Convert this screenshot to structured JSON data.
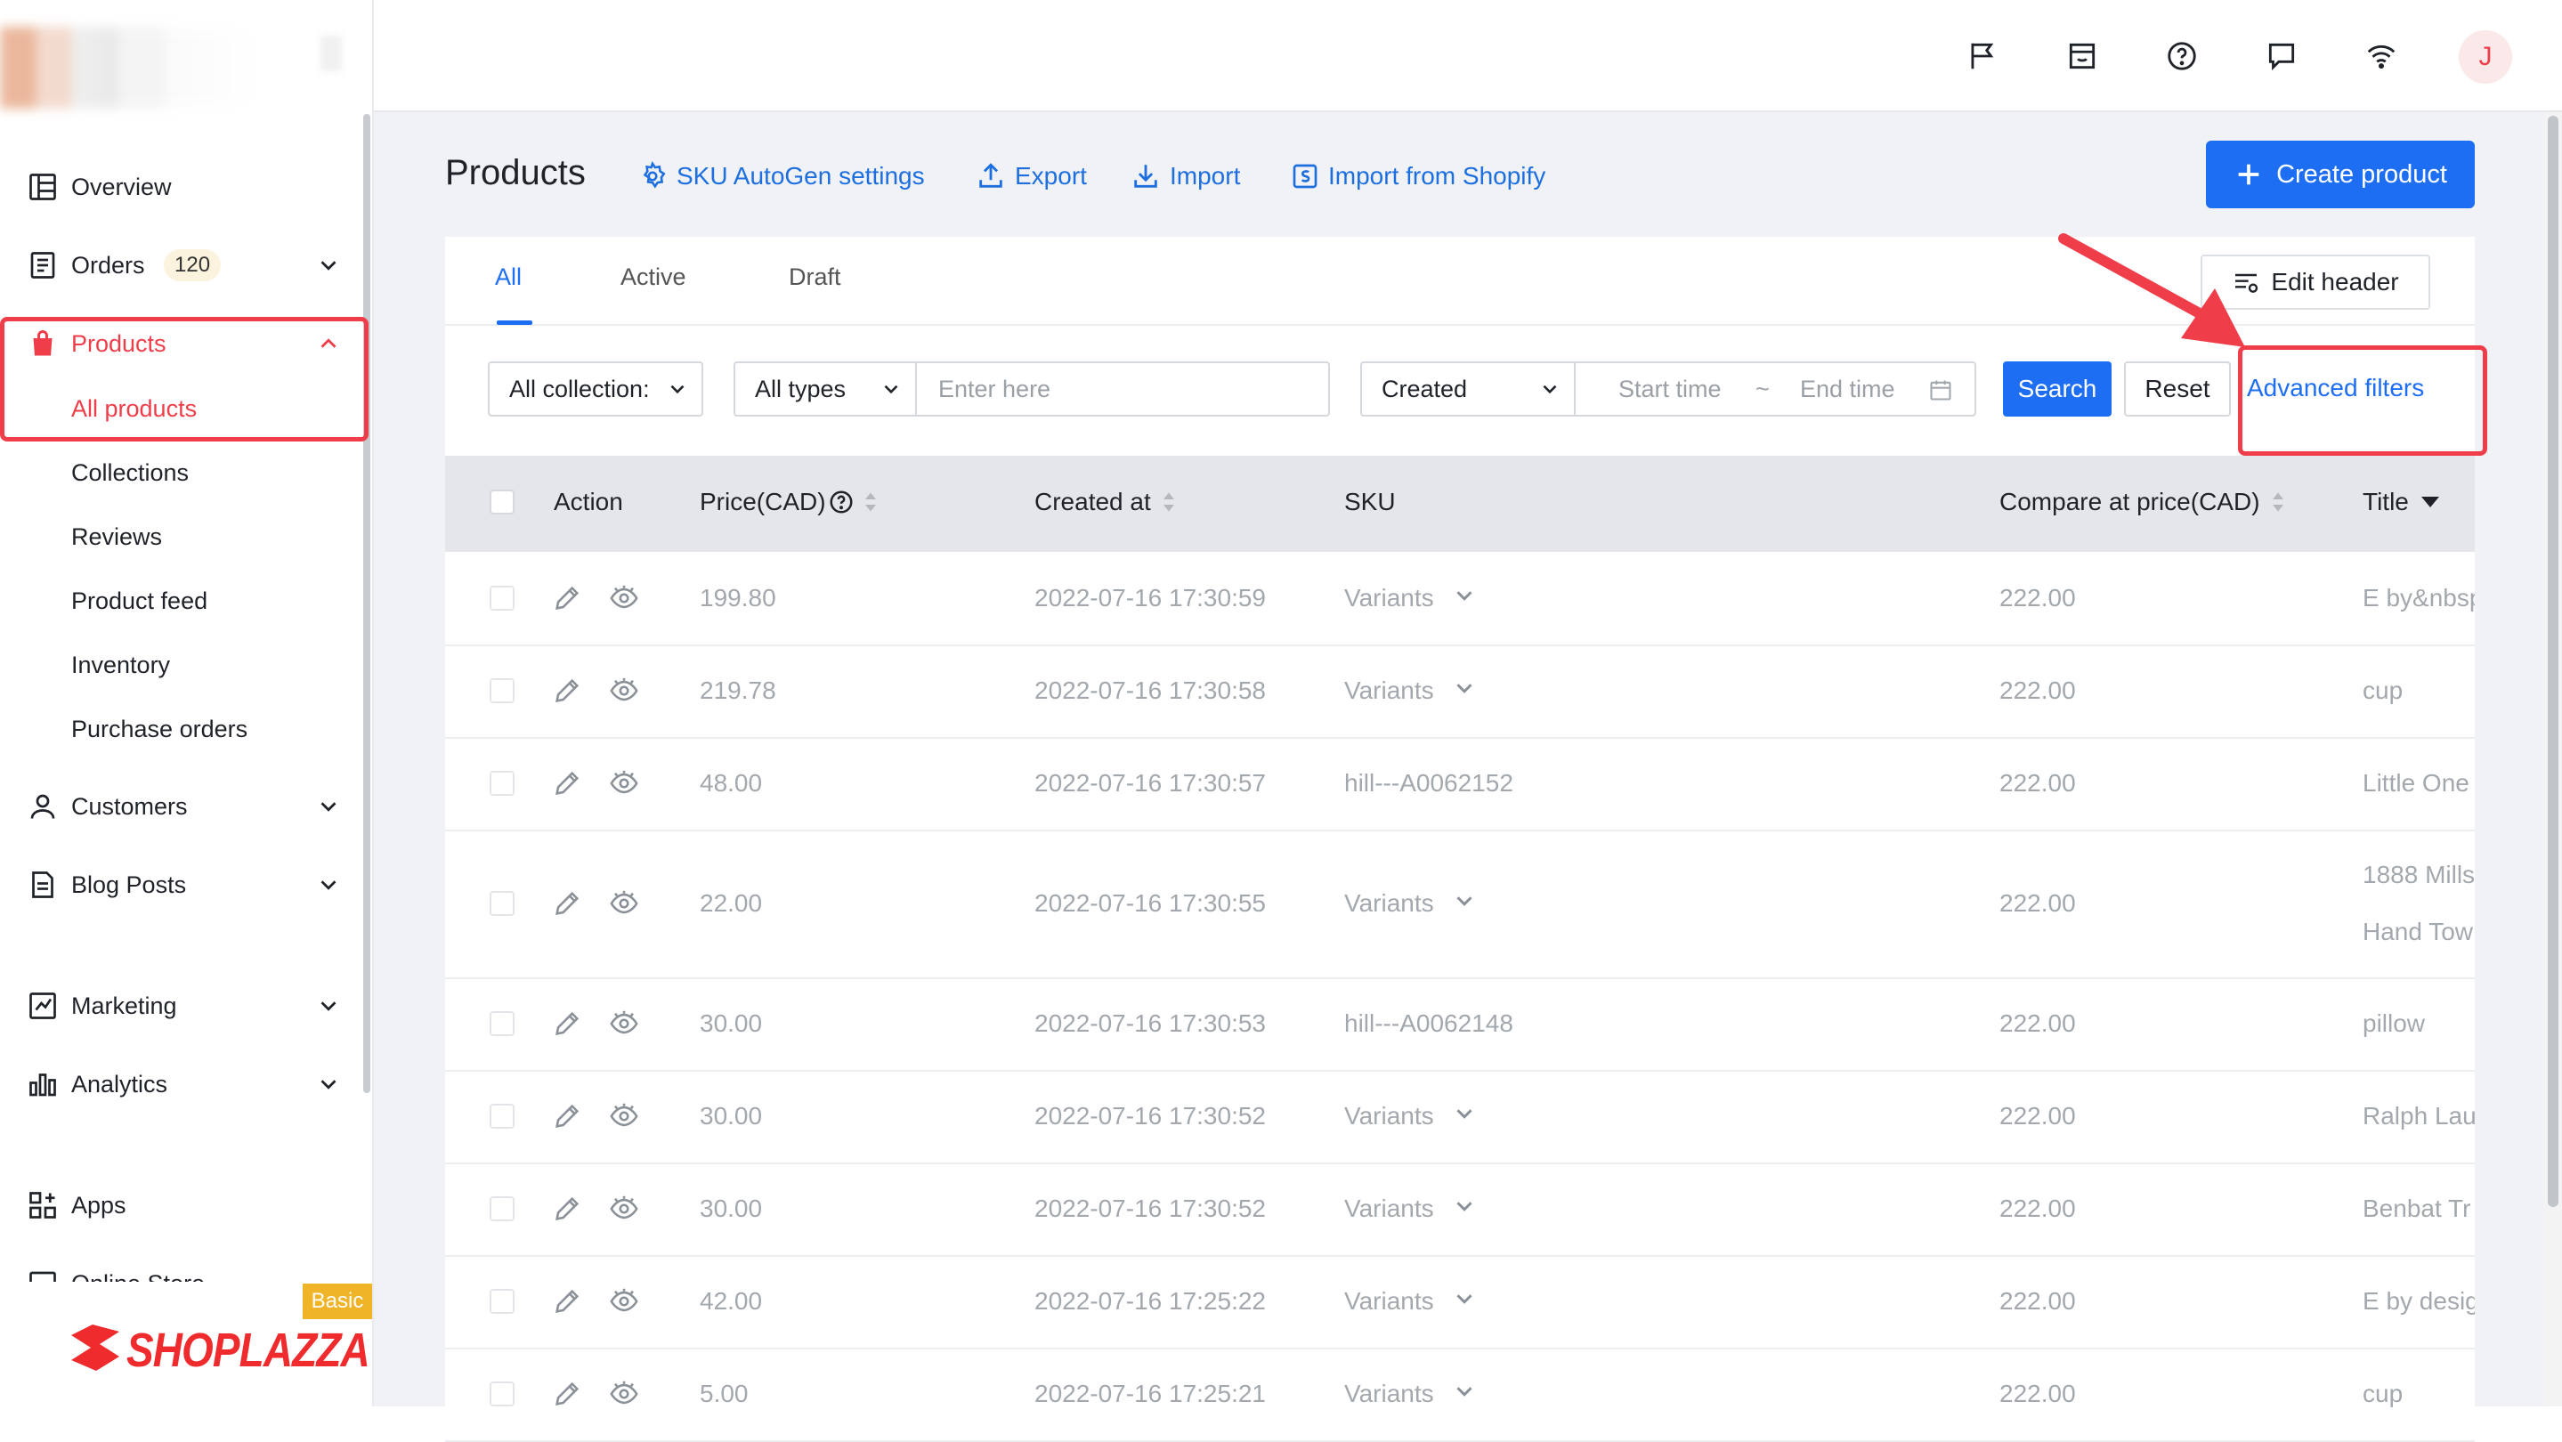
{
  "sidebar": {
    "items": [
      {
        "label": "Overview"
      },
      {
        "label": "Orders",
        "badge": "120"
      },
      {
        "label": "Products"
      },
      {
        "label": "Customers"
      },
      {
        "label": "Blog Posts"
      },
      {
        "label": "Marketing"
      },
      {
        "label": "Analytics"
      },
      {
        "label": "Apps"
      },
      {
        "label": "Online Store"
      }
    ],
    "product_subitems": [
      "All products",
      "Collections",
      "Reviews",
      "Product feed",
      "Inventory",
      "Purchase orders"
    ],
    "plan_badge": "Basic",
    "brand": "SHOPLAZZA"
  },
  "topbar": {
    "avatar_initial": "J"
  },
  "header": {
    "title": "Products",
    "sku_autogen": "SKU AutoGen settings",
    "export": "Export",
    "import": "Import",
    "import_shopify": "Import from Shopify",
    "create_product": "Create product"
  },
  "tabs": [
    "All",
    "Active",
    "Draft"
  ],
  "edit_header": "Edit header",
  "filters": {
    "collection": "All collection:",
    "types": "All types",
    "search_placeholder": "Enter here",
    "date_field": "Created",
    "start_placeholder": "Start time",
    "range_sep": "~",
    "end_placeholder": "End time",
    "search_button": "Search",
    "reset_button": "Reset",
    "advanced": "Advanced filters"
  },
  "columns": {
    "action": "Action",
    "price": "Price(CAD)",
    "created": "Created at",
    "sku": "SKU",
    "compare": "Compare at price(CAD)",
    "title": "Title"
  },
  "rows": [
    {
      "price": "199.80",
      "created": "2022-07-16 17:30:59",
      "sku": "Variants",
      "compare": "222.00",
      "title": [
        "E by&nbsp;"
      ]
    },
    {
      "price": "219.78",
      "created": "2022-07-16 17:30:58",
      "sku": "Variants",
      "compare": "222.00",
      "title": [
        "cup"
      ]
    },
    {
      "price": "48.00",
      "created": "2022-07-16 17:30:57",
      "sku": "hill---A0062152",
      "compare": "222.00",
      "title": [
        "Little One"
      ]
    },
    {
      "price": "22.00",
      "created": "2022-07-16 17:30:55",
      "sku": "Variants",
      "compare": "222.00",
      "title": [
        "1888 Mills",
        "Hand Tow"
      ]
    },
    {
      "price": "30.00",
      "created": "2022-07-16 17:30:53",
      "sku": "hill---A0062148",
      "compare": "222.00",
      "title": [
        "pillow"
      ]
    },
    {
      "price": "30.00",
      "created": "2022-07-16 17:30:52",
      "sku": "Variants",
      "compare": "222.00",
      "title": [
        "Ralph Lau"
      ]
    },
    {
      "price": "30.00",
      "created": "2022-07-16 17:30:52",
      "sku": "Variants",
      "compare": "222.00",
      "title": [
        "Benbat Tr"
      ]
    },
    {
      "price": "42.00",
      "created": "2022-07-16 17:25:22",
      "sku": "Variants",
      "compare": "222.00",
      "title": [
        "E by desig"
      ]
    },
    {
      "price": "5.00",
      "created": "2022-07-16 17:25:21",
      "sku": "Variants",
      "compare": "222.00",
      "title": [
        "cup"
      ]
    }
  ],
  "colors": {
    "accent": "#1e6ef4",
    "highlight": "#ef3e4a",
    "brand": "#ef2b2d"
  }
}
